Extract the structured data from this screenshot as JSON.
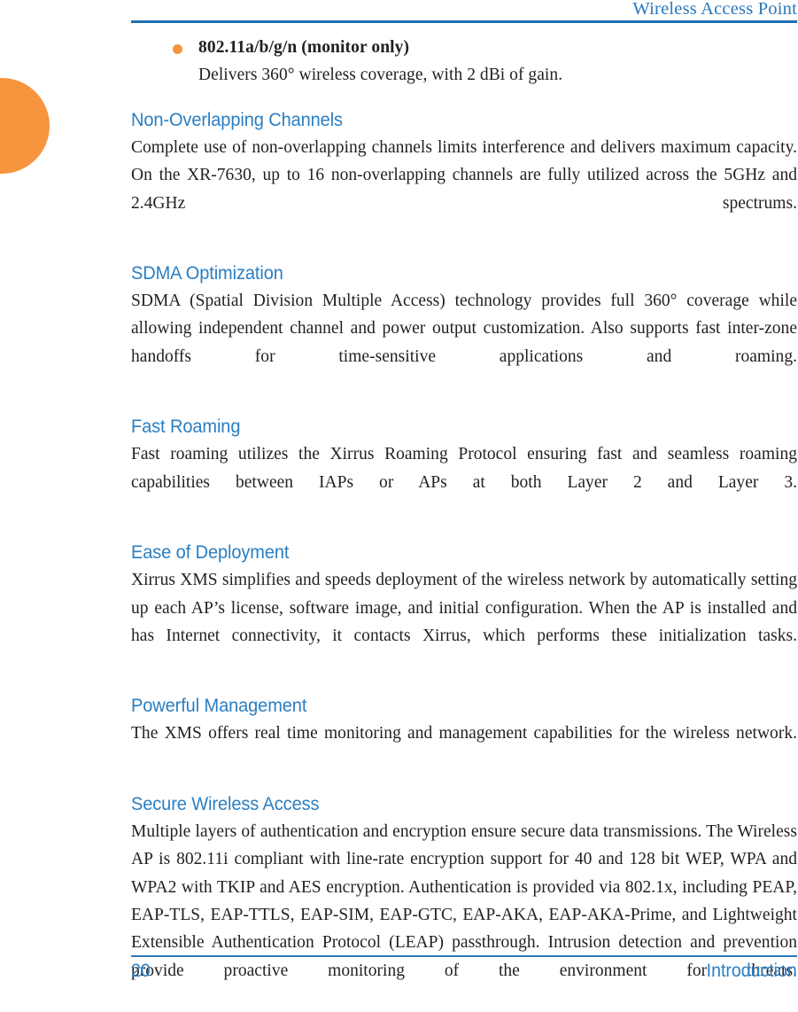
{
  "colors": {
    "accent_blue": "#2a7ec2",
    "rule_blue": "#1d6fb3",
    "accent_orange": "#f7943e",
    "body_text": "#231f20"
  },
  "header": {
    "title": "Wireless Access Point"
  },
  "bullets": [
    {
      "heading": "802.11a/b/g/n (monitor only)",
      "description": "Delivers 360° wireless coverage, with 2 dBi of gain."
    }
  ],
  "sections": [
    {
      "heading": "Non-Overlapping Channels",
      "body": "Complete use of non-overlapping channels limits interference and delivers maximum capacity. On the XR-7630, up to 16 non-overlapping channels are fully utilized across the 5GHz and 2.4GHz spectrums."
    },
    {
      "heading": "SDMA Optimization",
      "body": "SDMA (Spatial Division Multiple Access) technology provides full 360° coverage while allowing independent channel and power output customization. Also supports fast inter-zone handoffs for time-sensitive applications and roaming."
    },
    {
      "heading": "Fast Roaming",
      "body": "Fast roaming utilizes the Xirrus Roaming Protocol ensuring fast and seamless roaming capabilities between IAPs or APs at both Layer 2 and Layer 3."
    },
    {
      "heading": "Ease of Deployment",
      "body": "Xirrus XMS simplifies and speeds deployment of the wireless network by automatically setting up each AP’s license, software image, and initial configuration. When the AP is installed and has Internet connectivity, it contacts Xirrus, which performs these initialization tasks."
    },
    {
      "heading": "Powerful Management",
      "body": "The XMS offers real time monitoring and management capabilities for the wireless network."
    },
    {
      "heading": "Secure Wireless Access",
      "body": "Multiple layers of authentication and encryption ensure secure data transmissions. The Wireless AP is 802.11i compliant with line-rate encryption support for 40 and 128 bit WEP, WPA and WPA2 with TKIP and AES encryption. Authentication is provided via 802.1x, including PEAP, EAP-TLS, EAP-TTLS, EAP-SIM, EAP-GTC, EAP-AKA, EAP-AKA-Prime, and Lightweight Extensible Authentication Protocol (LEAP) passthrough. Intrusion detection and prevention provide proactive monitoring of the environment for threats."
    }
  ],
  "footer": {
    "page_number": "20",
    "section_name": "Introduction"
  }
}
